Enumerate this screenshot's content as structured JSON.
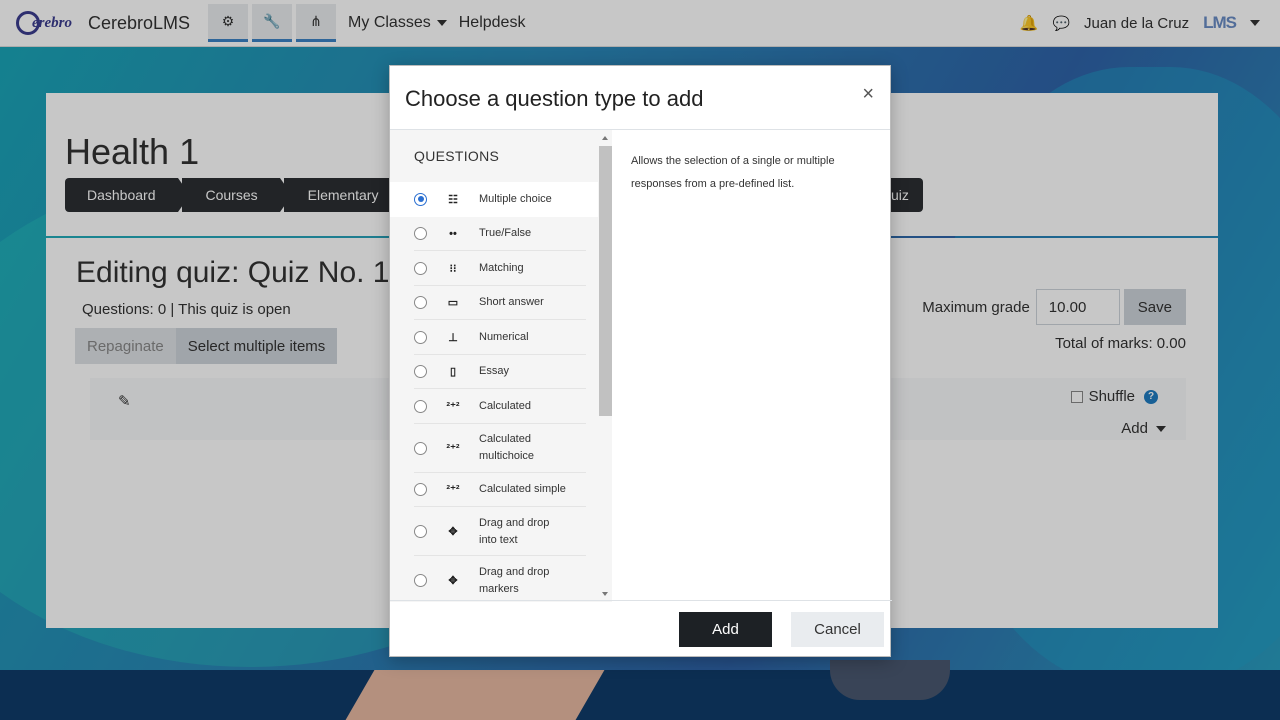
{
  "app": {
    "logo_text": "erebro",
    "name": "CerebroLMS"
  },
  "navbar": {
    "icons": [
      "cogs-icon",
      "wrench-icon",
      "sitemap-icon"
    ],
    "my_classes": "My Classes",
    "helpdesk": "Helpdesk",
    "user_name": "Juan de la Cruz",
    "user_logo": "LMS"
  },
  "course": {
    "title": "Health 1",
    "breadcrumbs": [
      "Dashboard",
      "Courses",
      "Elementary"
    ],
    "breadcrumb_tail": "uiz"
  },
  "quiz": {
    "title": "Editing quiz: Quiz No. 1",
    "info": "Questions: 0 | This quiz is open",
    "repaginate": "Repaginate",
    "select_multiple": "Select multiple items",
    "max_grade_label": "Maximum grade",
    "max_grade_value": "10.00",
    "save": "Save",
    "total_marks": "Total of marks: 0.00",
    "shuffle": "Shuffle",
    "add": "Add"
  },
  "modal": {
    "title": "Choose a question type to add",
    "close": "×",
    "list_heading": "QUESTIONS",
    "selected_index": 0,
    "description": "Allows the selection of a single or multiple responses from a pre-defined list.",
    "questions": [
      {
        "label": "Multiple choice",
        "icon": "list-icon"
      },
      {
        "label": "True/False",
        "icon": "two-dots-icon"
      },
      {
        "label": "Matching",
        "icon": "matching-icon"
      },
      {
        "label": "Short answer",
        "icon": "short-answer-icon"
      },
      {
        "label": "Numerical",
        "icon": "numerical-icon"
      },
      {
        "label": "Essay",
        "icon": "essay-icon"
      },
      {
        "label": "Calculated",
        "icon": "calculated-icon"
      },
      {
        "label": "Calculated multichoice",
        "icon": "calculated-multichoice-icon"
      },
      {
        "label": "Calculated simple",
        "icon": "calculated-simple-icon"
      },
      {
        "label": "Drag and drop into text",
        "icon": "move-arrows-icon"
      },
      {
        "label": "Drag and drop markers",
        "icon": "move-arrows-icon"
      }
    ],
    "add": "Add",
    "cancel": "Cancel"
  }
}
